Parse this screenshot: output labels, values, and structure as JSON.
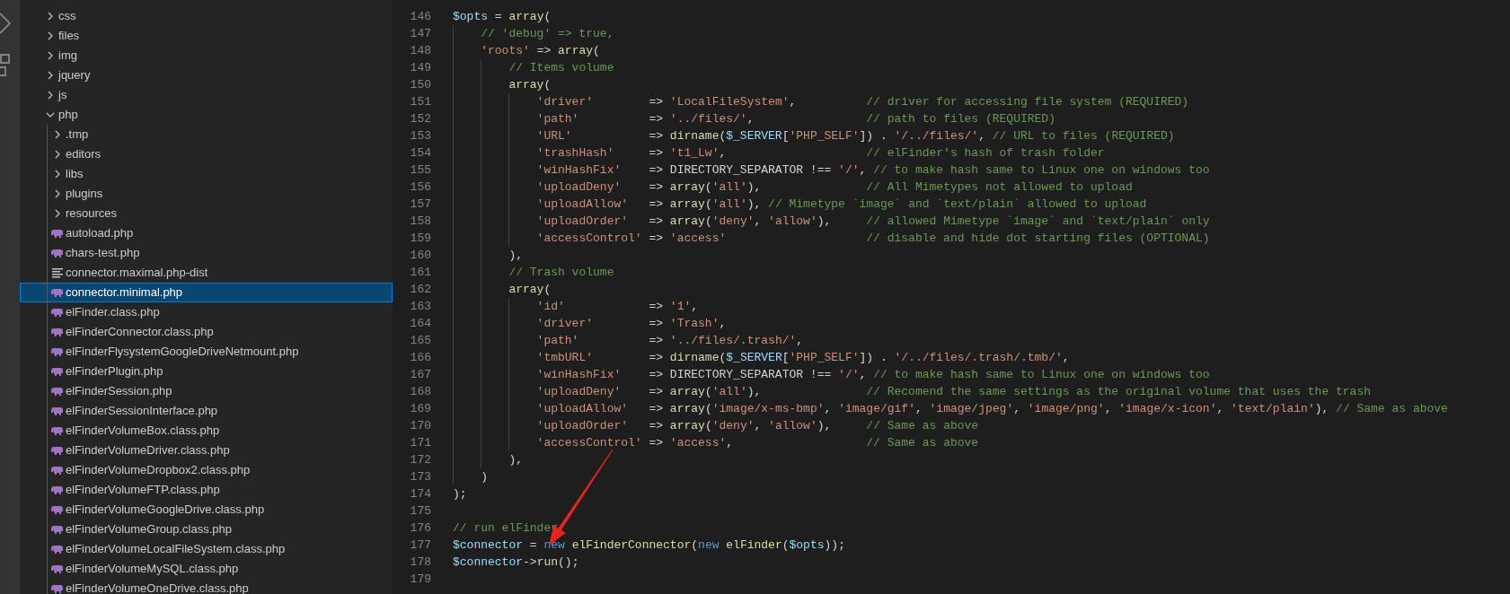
{
  "explorer": {
    "items": [
      {
        "label": "css",
        "kind": "folder",
        "expanded": false,
        "selected": false
      },
      {
        "label": "files",
        "kind": "folder",
        "expanded": false,
        "selected": false
      },
      {
        "label": "img",
        "kind": "folder",
        "expanded": false,
        "selected": false
      },
      {
        "label": "jquery",
        "kind": "folder",
        "expanded": false,
        "selected": false
      },
      {
        "label": "js",
        "kind": "folder",
        "expanded": false,
        "selected": false
      },
      {
        "label": "php",
        "kind": "folder",
        "expanded": true,
        "selected": false,
        "children": [
          {
            "label": ".tmp",
            "kind": "folder",
            "expanded": false,
            "selected": false
          },
          {
            "label": "editors",
            "kind": "folder",
            "expanded": false,
            "selected": false
          },
          {
            "label": "libs",
            "kind": "folder",
            "expanded": false,
            "selected": false
          },
          {
            "label": "plugins",
            "kind": "folder",
            "expanded": false,
            "selected": false
          },
          {
            "label": "resources",
            "kind": "folder",
            "expanded": false,
            "selected": false
          },
          {
            "label": "autoload.php",
            "kind": "php",
            "selected": false
          },
          {
            "label": "chars-test.php",
            "kind": "php",
            "selected": false
          },
          {
            "label": "connector.maximal.php-dist",
            "kind": "text",
            "selected": false
          },
          {
            "label": "connector.minimal.php",
            "kind": "php",
            "selected": true
          },
          {
            "label": "elFinder.class.php",
            "kind": "php",
            "selected": false
          },
          {
            "label": "elFinderConnector.class.php",
            "kind": "php",
            "selected": false
          },
          {
            "label": "elFinderFlysystemGoogleDriveNetmount.php",
            "kind": "php",
            "selected": false
          },
          {
            "label": "elFinderPlugin.php",
            "kind": "php",
            "selected": false
          },
          {
            "label": "elFinderSession.php",
            "kind": "php",
            "selected": false
          },
          {
            "label": "elFinderSessionInterface.php",
            "kind": "php",
            "selected": false
          },
          {
            "label": "elFinderVolumeBox.class.php",
            "kind": "php",
            "selected": false
          },
          {
            "label": "elFinderVolumeDriver.class.php",
            "kind": "php",
            "selected": false
          },
          {
            "label": "elFinderVolumeDropbox2.class.php",
            "kind": "php",
            "selected": false
          },
          {
            "label": "elFinderVolumeFTP.class.php",
            "kind": "php",
            "selected": false
          },
          {
            "label": "elFinderVolumeGoogleDrive.class.php",
            "kind": "php",
            "selected": false
          },
          {
            "label": "elFinderVolumeGroup.class.php",
            "kind": "php",
            "selected": false
          },
          {
            "label": "elFinderVolumeLocalFileSystem.class.php",
            "kind": "php",
            "selected": false
          },
          {
            "label": "elFinderVolumeMySQL.class.php",
            "kind": "php",
            "selected": false
          },
          {
            "label": "elFinderVolumeOneDrive.class.php",
            "kind": "php",
            "selected": false
          }
        ]
      }
    ]
  },
  "editor": {
    "lines": [
      {
        "number": "146",
        "tokens": [
          {
            "kind": "var",
            "text": "$opts"
          },
          {
            "kind": "op",
            "text": " = "
          },
          {
            "kind": "fn",
            "text": "array"
          },
          {
            "kind": "op",
            "text": "("
          }
        ]
      },
      {
        "number": "147",
        "tokens": [
          {
            "kind": "cmt",
            "text": "    // 'debug' => true,"
          }
        ]
      },
      {
        "number": "148",
        "tokens": [
          {
            "kind": "str",
            "text": "    'roots'"
          },
          {
            "kind": "op",
            "text": " => "
          },
          {
            "kind": "fn",
            "text": "array"
          },
          {
            "kind": "op",
            "text": "("
          }
        ]
      },
      {
        "number": "149",
        "tokens": [
          {
            "kind": "cmt",
            "text": "        // Items volume"
          }
        ]
      },
      {
        "number": "150",
        "tokens": [
          {
            "kind": "fn",
            "text": "        array"
          },
          {
            "kind": "op",
            "text": "("
          }
        ]
      },
      {
        "number": "151",
        "tokens": [
          {
            "kind": "str",
            "text": "            'driver'"
          },
          {
            "kind": "op",
            "text": "        => "
          },
          {
            "kind": "str",
            "text": "'LocalFileSystem'"
          },
          {
            "kind": "op",
            "text": ",          "
          },
          {
            "kind": "cmt",
            "text": "// driver for accessing file system (REQUIRED)"
          }
        ]
      },
      {
        "number": "152",
        "tokens": [
          {
            "kind": "str",
            "text": "            'path'"
          },
          {
            "kind": "op",
            "text": "          => "
          },
          {
            "kind": "str",
            "text": "'../files/'"
          },
          {
            "kind": "op",
            "text": ",                "
          },
          {
            "kind": "cmt",
            "text": "// path to files (REQUIRED)"
          }
        ]
      },
      {
        "number": "153",
        "tokens": [
          {
            "kind": "str",
            "text": "            'URL'"
          },
          {
            "kind": "op",
            "text": "           => "
          },
          {
            "kind": "fn",
            "text": "dirname"
          },
          {
            "kind": "op",
            "text": "("
          },
          {
            "kind": "var",
            "text": "$_SERVER"
          },
          {
            "kind": "op",
            "text": "["
          },
          {
            "kind": "str",
            "text": "'PHP_SELF'"
          },
          {
            "kind": "op",
            "text": "]) . "
          },
          {
            "kind": "str",
            "text": "'/../files/'"
          },
          {
            "kind": "op",
            "text": ", "
          },
          {
            "kind": "cmt",
            "text": "// URL to files (REQUIRED)"
          }
        ]
      },
      {
        "number": "154",
        "tokens": [
          {
            "kind": "str",
            "text": "            'trashHash'"
          },
          {
            "kind": "op",
            "text": "     => "
          },
          {
            "kind": "str",
            "text": "'t1_Lw'"
          },
          {
            "kind": "op",
            "text": ",                    "
          },
          {
            "kind": "cmt",
            "text": "// elFinder's hash of trash folder"
          }
        ]
      },
      {
        "number": "155",
        "tokens": [
          {
            "kind": "str",
            "text": "            'winHashFix'"
          },
          {
            "kind": "op",
            "text": "    => DIRECTORY_SEPARATOR !== "
          },
          {
            "kind": "str",
            "text": "'/'"
          },
          {
            "kind": "op",
            "text": ", "
          },
          {
            "kind": "cmt",
            "text": "// to make hash same to Linux one on windows too"
          }
        ]
      },
      {
        "number": "156",
        "tokens": [
          {
            "kind": "str",
            "text": "            'uploadDeny'"
          },
          {
            "kind": "op",
            "text": "    => "
          },
          {
            "kind": "fn",
            "text": "array"
          },
          {
            "kind": "op",
            "text": "("
          },
          {
            "kind": "str",
            "text": "'all'"
          },
          {
            "kind": "op",
            "text": "),               "
          },
          {
            "kind": "cmt",
            "text": "// All Mimetypes not allowed to upload"
          }
        ]
      },
      {
        "number": "157",
        "tokens": [
          {
            "kind": "str",
            "text": "            'uploadAllow'"
          },
          {
            "kind": "op",
            "text": "   => "
          },
          {
            "kind": "fn",
            "text": "array"
          },
          {
            "kind": "op",
            "text": "("
          },
          {
            "kind": "str",
            "text": "'all'"
          },
          {
            "kind": "op",
            "text": "), "
          },
          {
            "kind": "cmt",
            "text": "// Mimetype `image` and `text/plain` allowed to upload"
          }
        ]
      },
      {
        "number": "158",
        "tokens": [
          {
            "kind": "str",
            "text": "            'uploadOrder'"
          },
          {
            "kind": "op",
            "text": "   => "
          },
          {
            "kind": "fn",
            "text": "array"
          },
          {
            "kind": "op",
            "text": "("
          },
          {
            "kind": "str",
            "text": "'deny'"
          },
          {
            "kind": "op",
            "text": ", "
          },
          {
            "kind": "str",
            "text": "'allow'"
          },
          {
            "kind": "op",
            "text": "),     "
          },
          {
            "kind": "cmt",
            "text": "// allowed Mimetype `image` and `text/plain` only"
          }
        ]
      },
      {
        "number": "159",
        "tokens": [
          {
            "kind": "str",
            "text": "            'accessControl'"
          },
          {
            "kind": "op",
            "text": " => "
          },
          {
            "kind": "str",
            "text": "'access'"
          },
          {
            "kind": "cmt",
            "text": "                    // disable and hide dot starting files (OPTIONAL)"
          }
        ]
      },
      {
        "number": "160",
        "tokens": [
          {
            "kind": "op",
            "text": "        ),"
          }
        ]
      },
      {
        "number": "161",
        "tokens": [
          {
            "kind": "cmt",
            "text": "        // Trash volume"
          }
        ]
      },
      {
        "number": "162",
        "tokens": [
          {
            "kind": "fn",
            "text": "        array"
          },
          {
            "kind": "op",
            "text": "("
          }
        ]
      },
      {
        "number": "163",
        "tokens": [
          {
            "kind": "str",
            "text": "            'id'"
          },
          {
            "kind": "op",
            "text": "            => "
          },
          {
            "kind": "str",
            "text": "'1'"
          },
          {
            "kind": "op",
            "text": ","
          }
        ]
      },
      {
        "number": "164",
        "tokens": [
          {
            "kind": "str",
            "text": "            'driver'"
          },
          {
            "kind": "op",
            "text": "        => "
          },
          {
            "kind": "str",
            "text": "'Trash'"
          },
          {
            "kind": "op",
            "text": ","
          }
        ]
      },
      {
        "number": "165",
        "tokens": [
          {
            "kind": "str",
            "text": "            'path'"
          },
          {
            "kind": "op",
            "text": "          => "
          },
          {
            "kind": "str",
            "text": "'../files/.trash/'"
          },
          {
            "kind": "op",
            "text": ","
          }
        ]
      },
      {
        "number": "166",
        "tokens": [
          {
            "kind": "str",
            "text": "            'tmbURL'"
          },
          {
            "kind": "op",
            "text": "        => "
          },
          {
            "kind": "fn",
            "text": "dirname"
          },
          {
            "kind": "op",
            "text": "("
          },
          {
            "kind": "var",
            "text": "$_SERVER"
          },
          {
            "kind": "op",
            "text": "["
          },
          {
            "kind": "str",
            "text": "'PHP_SELF'"
          },
          {
            "kind": "op",
            "text": "]) . "
          },
          {
            "kind": "str",
            "text": "'/../files/.trash/.tmb/'"
          },
          {
            "kind": "op",
            "text": ","
          }
        ]
      },
      {
        "number": "167",
        "tokens": [
          {
            "kind": "str",
            "text": "            'winHashFix'"
          },
          {
            "kind": "op",
            "text": "    => DIRECTORY_SEPARATOR !== "
          },
          {
            "kind": "str",
            "text": "'/'"
          },
          {
            "kind": "op",
            "text": ", "
          },
          {
            "kind": "cmt",
            "text": "// to make hash same to Linux one on windows too"
          }
        ]
      },
      {
        "number": "168",
        "tokens": [
          {
            "kind": "str",
            "text": "            'uploadDeny'"
          },
          {
            "kind": "op",
            "text": "    => "
          },
          {
            "kind": "fn",
            "text": "array"
          },
          {
            "kind": "op",
            "text": "("
          },
          {
            "kind": "str",
            "text": "'all'"
          },
          {
            "kind": "op",
            "text": "),               "
          },
          {
            "kind": "cmt",
            "text": "// Recomend the same settings as the original volume that uses the trash"
          }
        ]
      },
      {
        "number": "169",
        "tokens": [
          {
            "kind": "str",
            "text": "            'uploadAllow'"
          },
          {
            "kind": "op",
            "text": "   => "
          },
          {
            "kind": "fn",
            "text": "array"
          },
          {
            "kind": "op",
            "text": "("
          },
          {
            "kind": "str",
            "text": "'image/x-ms-bmp'"
          },
          {
            "kind": "op",
            "text": ", "
          },
          {
            "kind": "str",
            "text": "'image/gif'"
          },
          {
            "kind": "op",
            "text": ", "
          },
          {
            "kind": "str",
            "text": "'image/jpeg'"
          },
          {
            "kind": "op",
            "text": ", "
          },
          {
            "kind": "str",
            "text": "'image/png'"
          },
          {
            "kind": "op",
            "text": ", "
          },
          {
            "kind": "str",
            "text": "'image/x-icon'"
          },
          {
            "kind": "op",
            "text": ", "
          },
          {
            "kind": "str",
            "text": "'text/plain'"
          },
          {
            "kind": "op",
            "text": "), "
          },
          {
            "kind": "cmt",
            "text": "// Same as above"
          }
        ]
      },
      {
        "number": "170",
        "tokens": [
          {
            "kind": "str",
            "text": "            'uploadOrder'"
          },
          {
            "kind": "op",
            "text": "   => "
          },
          {
            "kind": "fn",
            "text": "array"
          },
          {
            "kind": "op",
            "text": "("
          },
          {
            "kind": "str",
            "text": "'deny'"
          },
          {
            "kind": "op",
            "text": ", "
          },
          {
            "kind": "str",
            "text": "'allow'"
          },
          {
            "kind": "op",
            "text": "),     "
          },
          {
            "kind": "cmt",
            "text": "// Same as above"
          }
        ]
      },
      {
        "number": "171",
        "tokens": [
          {
            "kind": "str",
            "text": "            'accessControl'"
          },
          {
            "kind": "op",
            "text": " => "
          },
          {
            "kind": "str",
            "text": "'access'"
          },
          {
            "kind": "op",
            "text": ",                   "
          },
          {
            "kind": "cmt",
            "text": "// Same as above"
          }
        ]
      },
      {
        "number": "172",
        "tokens": [
          {
            "kind": "op",
            "text": "        ),"
          }
        ]
      },
      {
        "number": "173",
        "tokens": [
          {
            "kind": "op",
            "text": "    )"
          }
        ]
      },
      {
        "number": "174",
        "tokens": [
          {
            "kind": "op",
            "text": ");"
          }
        ]
      },
      {
        "number": "175"
      },
      {
        "number": "176",
        "tokens": [
          {
            "kind": "cmt",
            "text": "// run elFinder"
          }
        ]
      },
      {
        "number": "177",
        "tokens": [
          {
            "kind": "var",
            "text": "$connector"
          },
          {
            "kind": "op",
            "text": " = "
          },
          {
            "kind": "kw",
            "text": "new"
          },
          {
            "kind": "fn",
            "text": " elFinderConnector"
          },
          {
            "kind": "op",
            "text": "("
          },
          {
            "kind": "kw",
            "text": "new"
          },
          {
            "kind": "fn",
            "text": " elFinder"
          },
          {
            "kind": "op",
            "text": "("
          },
          {
            "kind": "var",
            "text": "$opts"
          },
          {
            "kind": "op",
            "text": "));"
          }
        ]
      },
      {
        "number": "178",
        "tokens": [
          {
            "kind": "var",
            "text": "$connector"
          },
          {
            "kind": "op",
            "text": "->"
          },
          {
            "kind": "fn",
            "text": "run"
          },
          {
            "kind": "op",
            "text": "();"
          }
        ]
      },
      {
        "number": "179"
      }
    ]
  }
}
